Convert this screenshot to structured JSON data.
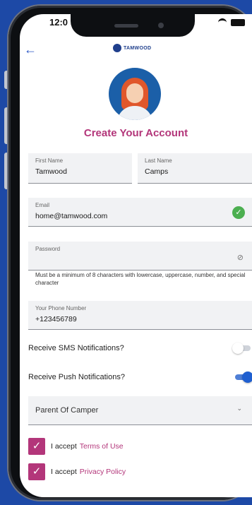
{
  "status": {
    "time": "12:0"
  },
  "brand": {
    "name": "TAMWOOD"
  },
  "title": "Create Your Account",
  "form": {
    "first_name": {
      "label": "First Name",
      "value": "Tamwood"
    },
    "last_name": {
      "label": "Last Name",
      "value": "Camps"
    },
    "email": {
      "label": "Email",
      "value": "home@tamwood.com"
    },
    "password": {
      "label": "Password",
      "value": ""
    },
    "password_hint": "Must be a minimum of 8 characters with  lowercase, uppercase, number, and special character",
    "phone": {
      "label": "Your Phone Number",
      "value": "+123456789"
    }
  },
  "toggles": {
    "sms": {
      "label": "Receive SMS Notifications?",
      "on": false
    },
    "push": {
      "label": "Receive Push Notifications?",
      "on": true
    }
  },
  "role_select": {
    "value": "Parent Of Camper"
  },
  "accept": {
    "terms": {
      "prefix": "I accept",
      "link": "Terms of Use",
      "checked": true
    },
    "privacy": {
      "prefix": "I accept",
      "link": "Privacy Policy",
      "checked": true
    }
  },
  "colors": {
    "accent": "#b3367a",
    "background": "#1d49a6",
    "success": "#4caf50",
    "toggle_on": "#1f5fd0"
  },
  "icons": {
    "back": "back-arrow-icon",
    "verified": "check-circle-icon",
    "password_visibility": "eye-off-icon",
    "select": "chevron-down-icon",
    "checkbox": "checkbox-checked-icon"
  }
}
